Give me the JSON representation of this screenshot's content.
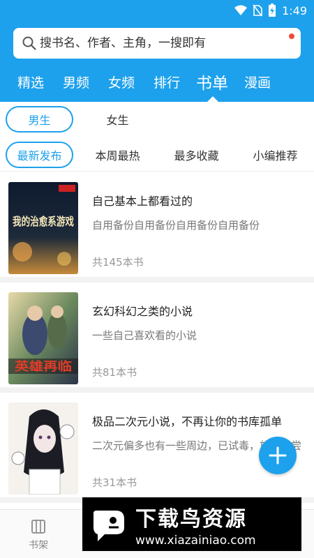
{
  "status": {
    "time": "1:49"
  },
  "search": {
    "placeholder": "搜书名、作者、主角，一搜即有"
  },
  "tabs": [
    "精选",
    "男频",
    "女频",
    "排行",
    "书单",
    "漫画"
  ],
  "active_tab": "书单",
  "gender": [
    "男生",
    "女生"
  ],
  "sorts": [
    "最新发布",
    "本周最热",
    "最多收藏",
    "小编推荐"
  ],
  "cover_texts": {
    "c1_title": "我的治愈系游戏",
    "c2_title": "英雄再临"
  },
  "booklists": [
    {
      "title": "自己基本上都看过的",
      "desc": "自用备份自用备份自用备份自用备份",
      "count": "共145本书"
    },
    {
      "title": "玄幻科幻之类的小说",
      "desc": "一些自己喜欢看的小说",
      "count": "共81本书"
    },
    {
      "title": "极品二次元小说，不再让你的书库孤单",
      "desc": "二次元偏多也有一些周边，已试毒，放心品尝",
      "count": "共31本书"
    }
  ],
  "bottom_nav": {
    "label": "书架"
  },
  "watermark": {
    "cn": "下载鸟资源",
    "url": "www.xiazainiao.com"
  },
  "colors": {
    "accent": "#1ea1ec",
    "badge": "#f04a3a"
  }
}
